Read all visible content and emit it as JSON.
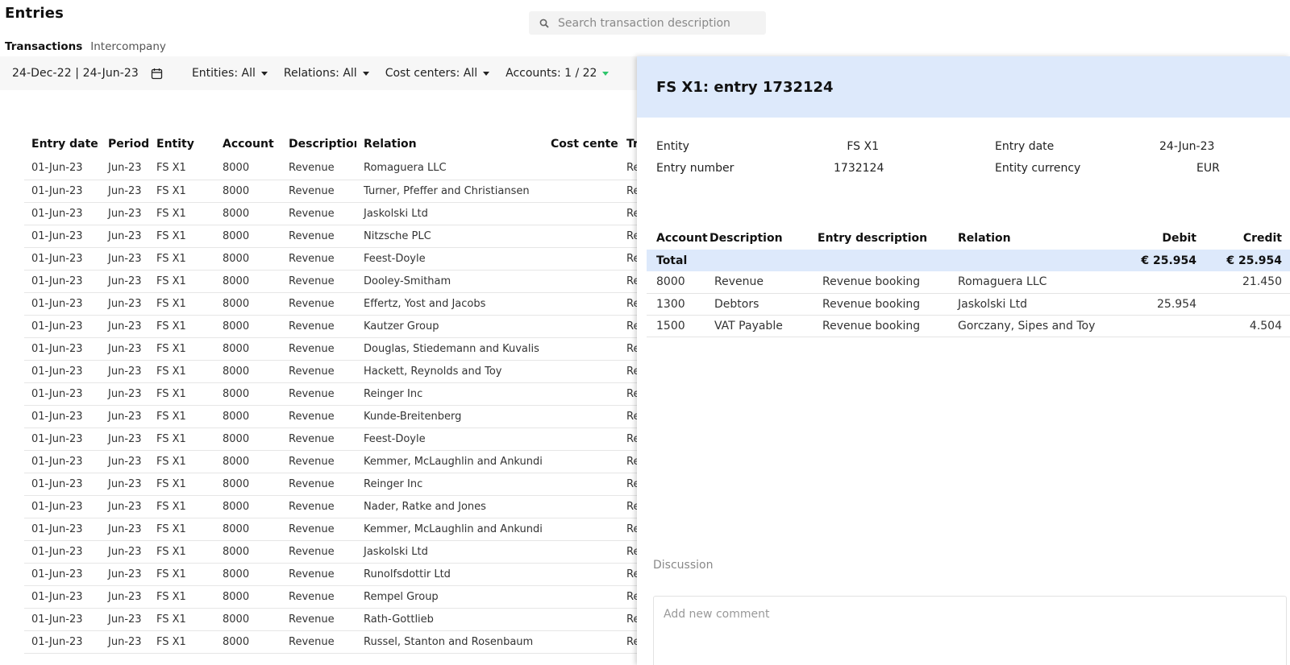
{
  "page": {
    "title": "Entries"
  },
  "search": {
    "placeholder": "Search transaction description"
  },
  "tabs": [
    {
      "label": "Transactions"
    },
    {
      "label": "Intercompany"
    }
  ],
  "filters": {
    "date_range": "24-Dec-22 | 24-Jun-23",
    "entities": "Entities: All",
    "relations": "Relations: All",
    "cost_centers": "Cost centers: All",
    "accounts": "Accounts: 1 / 22",
    "accounts_caret_color": "#2ec56b"
  },
  "entries_table": {
    "columns": [
      "Entry date",
      "Period",
      "Entity",
      "Account",
      "Description",
      "Relation",
      "Cost center",
      "Tr"
    ],
    "rows": [
      [
        "01-Jun-23",
        "Jun-23",
        "FS X1",
        "8000",
        "Revenue",
        "Romaguera LLC",
        "",
        "Re"
      ],
      [
        "01-Jun-23",
        "Jun-23",
        "FS X1",
        "8000",
        "Revenue",
        "Turner, Pfeffer and Christiansen",
        "",
        "Re"
      ],
      [
        "01-Jun-23",
        "Jun-23",
        "FS X1",
        "8000",
        "Revenue",
        "Jaskolski Ltd",
        "",
        "Re"
      ],
      [
        "01-Jun-23",
        "Jun-23",
        "FS X1",
        "8000",
        "Revenue",
        "Nitzsche PLC",
        "",
        "Re"
      ],
      [
        "01-Jun-23",
        "Jun-23",
        "FS X1",
        "8000",
        "Revenue",
        "Feest-Doyle",
        "",
        "Re"
      ],
      [
        "01-Jun-23",
        "Jun-23",
        "FS X1",
        "8000",
        "Revenue",
        "Dooley-Smitham",
        "",
        "Re"
      ],
      [
        "01-Jun-23",
        "Jun-23",
        "FS X1",
        "8000",
        "Revenue",
        "Effertz, Yost and Jacobs",
        "",
        "Re"
      ],
      [
        "01-Jun-23",
        "Jun-23",
        "FS X1",
        "8000",
        "Revenue",
        "Kautzer Group",
        "",
        "Re"
      ],
      [
        "01-Jun-23",
        "Jun-23",
        "FS X1",
        "8000",
        "Revenue",
        "Douglas, Stiedemann and Kuvalis",
        "",
        "Re"
      ],
      [
        "01-Jun-23",
        "Jun-23",
        "FS X1",
        "8000",
        "Revenue",
        "Hackett, Reynolds and Toy",
        "",
        "Re"
      ],
      [
        "01-Jun-23",
        "Jun-23",
        "FS X1",
        "8000",
        "Revenue",
        "Reinger Inc",
        "",
        "Re"
      ],
      [
        "01-Jun-23",
        "Jun-23",
        "FS X1",
        "8000",
        "Revenue",
        "Kunde-Breitenberg",
        "",
        "Re"
      ],
      [
        "01-Jun-23",
        "Jun-23",
        "FS X1",
        "8000",
        "Revenue",
        "Feest-Doyle",
        "",
        "Re"
      ],
      [
        "01-Jun-23",
        "Jun-23",
        "FS X1",
        "8000",
        "Revenue",
        "Kemmer, McLaughlin and Ankunding",
        "",
        "Re"
      ],
      [
        "01-Jun-23",
        "Jun-23",
        "FS X1",
        "8000",
        "Revenue",
        "Reinger Inc",
        "",
        "Re"
      ],
      [
        "01-Jun-23",
        "Jun-23",
        "FS X1",
        "8000",
        "Revenue",
        "Nader, Ratke and Jones",
        "",
        "Re"
      ],
      [
        "01-Jun-23",
        "Jun-23",
        "FS X1",
        "8000",
        "Revenue",
        "Kemmer, McLaughlin and Ankunding",
        "",
        "Re"
      ],
      [
        "01-Jun-23",
        "Jun-23",
        "FS X1",
        "8000",
        "Revenue",
        "Jaskolski Ltd",
        "",
        "Re"
      ],
      [
        "01-Jun-23",
        "Jun-23",
        "FS X1",
        "8000",
        "Revenue",
        "Runolfsdottir Ltd",
        "",
        "Re"
      ],
      [
        "01-Jun-23",
        "Jun-23",
        "FS X1",
        "8000",
        "Revenue",
        "Rempel Group",
        "",
        "Re"
      ],
      [
        "01-Jun-23",
        "Jun-23",
        "FS X1",
        "8000",
        "Revenue",
        "Rath-Gottlieb",
        "",
        "Re"
      ],
      [
        "01-Jun-23",
        "Jun-23",
        "FS X1",
        "8000",
        "Revenue",
        "Russel, Stanton and Rosenbaum",
        "",
        "Re"
      ]
    ]
  },
  "detail": {
    "title": "FS X1: entry 1732124",
    "entity_label": "Entity",
    "entity_value": "FS X1",
    "entry_number_label": "Entry number",
    "entry_number_value": "1732124",
    "entry_date_label": "Entry date",
    "entry_date_value": "24-Jun-23",
    "currency_label": "Entity currency",
    "currency_value": "EUR",
    "lines": {
      "columns": [
        "Account",
        "Description",
        "Entry description",
        "Relation",
        "Debit",
        "Credit"
      ],
      "total": {
        "label": "Total",
        "debit": "€ 25.954",
        "credit": "€ 25.954"
      },
      "rows": [
        [
          "8000",
          "Revenue",
          "Revenue booking",
          "Romaguera LLC",
          "",
          "21.450"
        ],
        [
          "1300",
          "Debtors",
          "Revenue booking",
          "Jaskolski Ltd",
          "25.954",
          ""
        ],
        [
          "1500",
          "VAT Payable",
          "Revenue booking",
          "Gorczany, Sipes and Toy",
          "",
          "4.504"
        ]
      ]
    },
    "discussion_label": "Discussion",
    "comment_placeholder": "Add new comment"
  },
  "colors": {
    "panel_header_bg": "#dde9fb",
    "total_row_bg": "#dde9fb",
    "accent_green": "#2ec56b"
  },
  "icons": {
    "search": "search-icon",
    "calendar": "calendar-icon"
  }
}
